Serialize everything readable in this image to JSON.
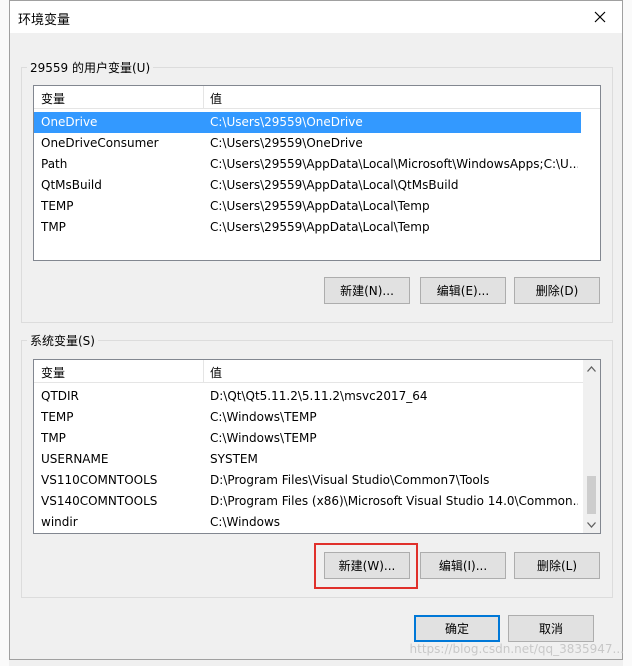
{
  "dialog": {
    "title": "环境变量",
    "close_icon": "close-icon"
  },
  "user_section": {
    "label": "29559 的用户变量(U)",
    "columns": [
      "变量",
      "值"
    ],
    "rows": [
      {
        "name": "OneDrive",
        "value": "C:\\Users\\29559\\OneDrive",
        "selected": true
      },
      {
        "name": "OneDriveConsumer",
        "value": "C:\\Users\\29559\\OneDrive",
        "selected": false
      },
      {
        "name": "Path",
        "value": "C:\\Users\\29559\\AppData\\Local\\Microsoft\\WindowsApps;C:\\U...",
        "selected": false
      },
      {
        "name": "QtMsBuild",
        "value": "C:\\Users\\29559\\AppData\\Local\\QtMsBuild",
        "selected": false
      },
      {
        "name": "TEMP",
        "value": "C:\\Users\\29559\\AppData\\Local\\Temp",
        "selected": false
      },
      {
        "name": "TMP",
        "value": "C:\\Users\\29559\\AppData\\Local\\Temp",
        "selected": false
      }
    ],
    "buttons": {
      "new": "新建(N)...",
      "edit": "编辑(E)...",
      "delete": "删除(D)"
    }
  },
  "system_section": {
    "label": "系统变量(S)",
    "columns": [
      "变量",
      "值"
    ],
    "rows": [
      {
        "name": "QTDIR",
        "value": "D:\\Qt\\Qt5.11.2\\5.11.2\\msvc2017_64"
      },
      {
        "name": "TEMP",
        "value": "C:\\Windows\\TEMP"
      },
      {
        "name": "TMP",
        "value": "C:\\Windows\\TEMP"
      },
      {
        "name": "USERNAME",
        "value": "SYSTEM"
      },
      {
        "name": "VS110COMNTOOLS",
        "value": "D:\\Program Files\\Visual Studio\\Common7\\Tools"
      },
      {
        "name": "VS140COMNTOOLS",
        "value": "D:\\Program Files (x86)\\Microsoft Visual Studio 14.0\\Common..."
      },
      {
        "name": "windir",
        "value": "C:\\Windows"
      }
    ],
    "buttons": {
      "new": "新建(W)...",
      "edit": "编辑(I)...",
      "delete": "删除(L)"
    }
  },
  "footer": {
    "ok": "确定",
    "cancel": "取消"
  },
  "watermark": "https://blog.csdn.net/qq_3835947...",
  "colors": {
    "selection": "#3399ff",
    "highlight": "#e0302b",
    "default_border": "#0078d7"
  }
}
